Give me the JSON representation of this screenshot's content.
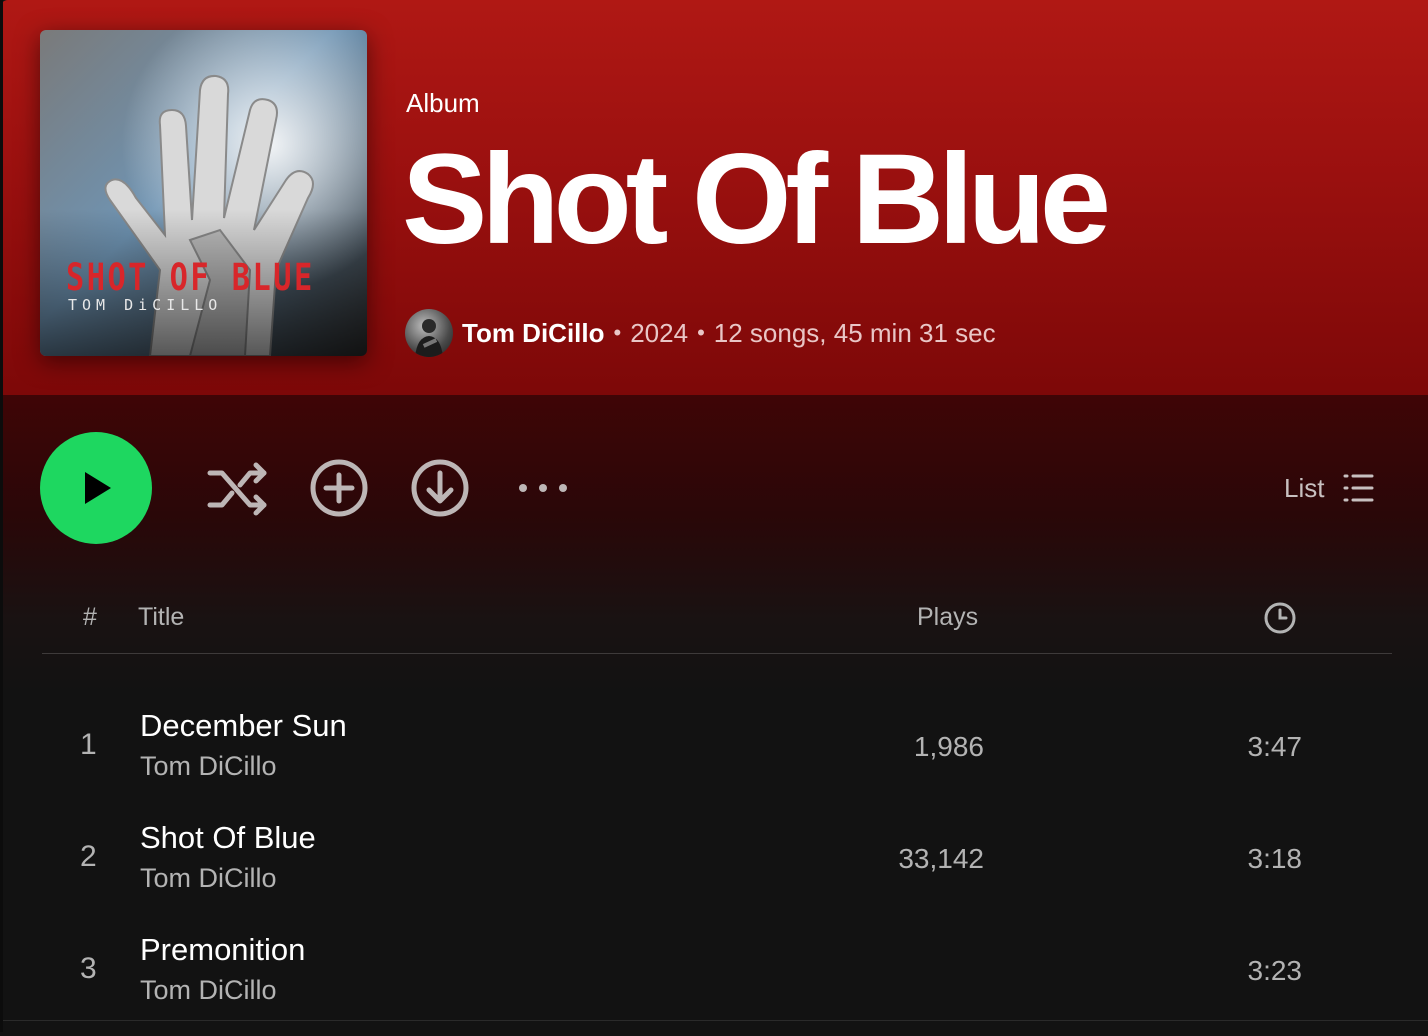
{
  "album": {
    "type_label": "Album",
    "title": "Shot Of Blue",
    "artist": "Tom DiCillo",
    "year": "2024",
    "summary": "12 songs, 45 min 31 sec",
    "cover": {
      "title_text": "SHOT OF BLUE",
      "artist_text": "TOM DiCILLO",
      "title_color": "#d8262a"
    }
  },
  "actions": {
    "play_icon": "play-icon",
    "shuffle_icon": "shuffle-icon",
    "add_icon": "add-circle-icon",
    "download_icon": "download-icon",
    "more_icon": "more-icon",
    "view_label": "List",
    "view_icon": "list-view-icon"
  },
  "table": {
    "headers": {
      "number": "#",
      "title": "Title",
      "plays": "Plays",
      "duration_icon": "clock-icon"
    },
    "rows": [
      {
        "number": "1",
        "title": "December Sun",
        "artist": "Tom DiCillo",
        "plays": "1,986",
        "duration": "3:47"
      },
      {
        "number": "2",
        "title": "Shot Of Blue",
        "artist": "Tom DiCillo",
        "plays": "33,142",
        "duration": "3:18"
      },
      {
        "number": "3",
        "title": "Premonition",
        "artist": "Tom DiCillo",
        "plays": "",
        "duration": "3:23"
      }
    ]
  },
  "colors": {
    "hero_red": "#b01814",
    "play_green": "#1ed760",
    "background": "#121212"
  }
}
